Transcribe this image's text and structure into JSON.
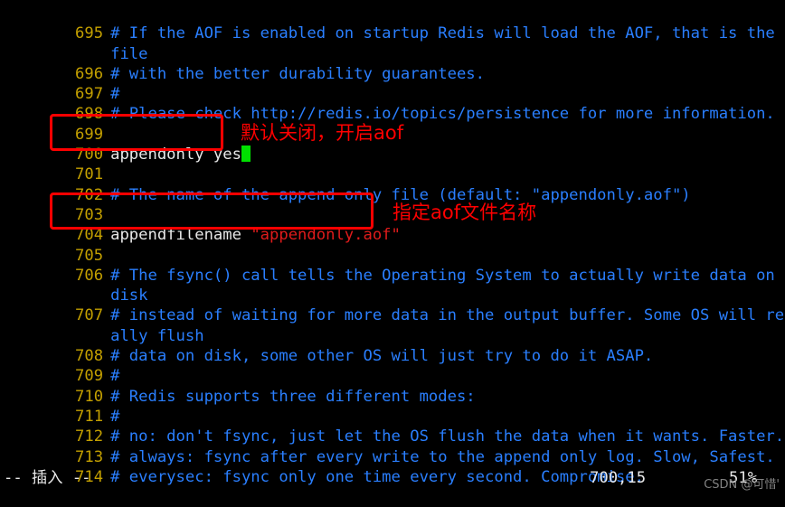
{
  "terminal": {
    "background": "#000000",
    "colors": {
      "line_number": "#c4a000",
      "comment": "#2a7fff",
      "plain_text": "#e8e8e8",
      "string": "#e01b1b",
      "cursor": "#00e000",
      "annotation": "#ff0000",
      "watermark": "#9a9a9a"
    }
  },
  "editor": {
    "lines": [
      {
        "num": "695",
        "kind": "comment",
        "text": "# If the AOF is enabled on startup Redis will load the AOF, that is the"
      },
      {
        "num": "",
        "kind": "comment",
        "text": "file",
        "wrapped": true
      },
      {
        "num": "696",
        "kind": "comment",
        "text": "# with the better durability guarantees."
      },
      {
        "num": "697",
        "kind": "comment",
        "text": "#"
      },
      {
        "num": "698",
        "kind": "comment",
        "text": "# Please check http://redis.io/topics/persistence for more information."
      },
      {
        "num": "699",
        "kind": "comment",
        "text": ""
      },
      {
        "num": "700",
        "kind": "config",
        "text": "appendonly yes",
        "cursor": true
      },
      {
        "num": "701",
        "kind": "comment",
        "text": ""
      },
      {
        "num": "702",
        "kind": "comment",
        "text": "# The name of the append only file (default: \"appendonly.aof\")"
      },
      {
        "num": "703",
        "kind": "comment",
        "text": ""
      },
      {
        "num": "704",
        "kind": "config_string",
        "text": "appendfilename ",
        "string": "\"appendonly.aof\""
      },
      {
        "num": "705",
        "kind": "comment",
        "text": ""
      },
      {
        "num": "706",
        "kind": "comment",
        "text": "# The fsync() call tells the Operating System to actually write data on"
      },
      {
        "num": "",
        "kind": "comment",
        "text": "disk",
        "wrapped": true
      },
      {
        "num": "707",
        "kind": "comment",
        "text": "# instead of waiting for more data in the output buffer. Some OS will re"
      },
      {
        "num": "",
        "kind": "comment",
        "text": "ally flush",
        "wrapped": true
      },
      {
        "num": "708",
        "kind": "comment",
        "text": "# data on disk, some other OS will just try to do it ASAP."
      },
      {
        "num": "709",
        "kind": "comment",
        "text": "#"
      },
      {
        "num": "710",
        "kind": "comment",
        "text": "# Redis supports three different modes:"
      },
      {
        "num": "711",
        "kind": "comment",
        "text": "#"
      },
      {
        "num": "712",
        "kind": "comment",
        "text": "# no: don't fsync, just let the OS flush the data when it wants. Faster."
      },
      {
        "num": "713",
        "kind": "comment",
        "text": "# always: fsync after every write to the append only log. Slow, Safest."
      },
      {
        "num": "714",
        "kind": "comment",
        "text": "# everysec: fsync only one time every second. Compromise."
      }
    ]
  },
  "annotations": [
    {
      "id": "note-appendonly",
      "text": "默认关闭，开启aof",
      "color": "#ff0000"
    },
    {
      "id": "note-appendfilename",
      "text": "指定aof文件名称",
      "color": "#ff0000"
    }
  ],
  "status": {
    "mode": "-- 插入 --",
    "position": "700,15",
    "percent": "51%"
  },
  "watermark": {
    "text": "CSDN @可惜'"
  }
}
